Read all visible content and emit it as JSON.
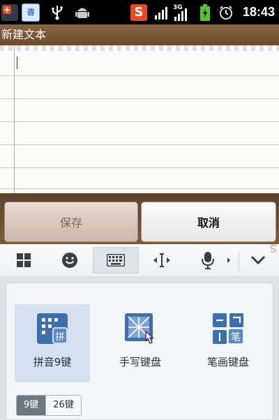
{
  "status_bar": {
    "time": "18:43",
    "network_type": "3G",
    "app_badge_1": "+",
    "app_badge_2": "咨",
    "sogou_badge": "S",
    "icons": [
      "app-notification-icon",
      "app-notification-icon",
      "usb-icon",
      "android-debug-icon",
      "sogou-input-icon",
      "signal-icon",
      "signal-3g-icon",
      "battery-charging-icon",
      "alarm-icon"
    ]
  },
  "title_bar": {
    "title": "新建文本"
  },
  "note": {
    "text": ""
  },
  "buttons": {
    "save_label": "保存",
    "cancel_label": "取消"
  },
  "ime_toolbar": {
    "icons": [
      "grid-icon",
      "emoji-icon",
      "keyboard-icon",
      "cursor-move-icon",
      "microphone-icon",
      "more-arrow-icon",
      "collapse-icon"
    ],
    "selected": "keyboard-icon"
  },
  "keyboard_panel": {
    "options": [
      {
        "label": "拼音9键",
        "icon": "pinyin-9-icon",
        "icon_char": "拼",
        "selected": true
      },
      {
        "label": "手写键盘",
        "icon": "handwriting-icon",
        "selected": false
      },
      {
        "label": "笔画键盘",
        "icon": "stroke-icon",
        "icon_char": "笔",
        "selected": false
      }
    ],
    "layout_toggle": {
      "options": [
        "9键",
        "26键"
      ],
      "selected": "9键"
    }
  },
  "colors": {
    "title_bar": "#7a5535",
    "ime_accent": "#3d6fae",
    "selected_option_bg": "#d5e1ef"
  }
}
